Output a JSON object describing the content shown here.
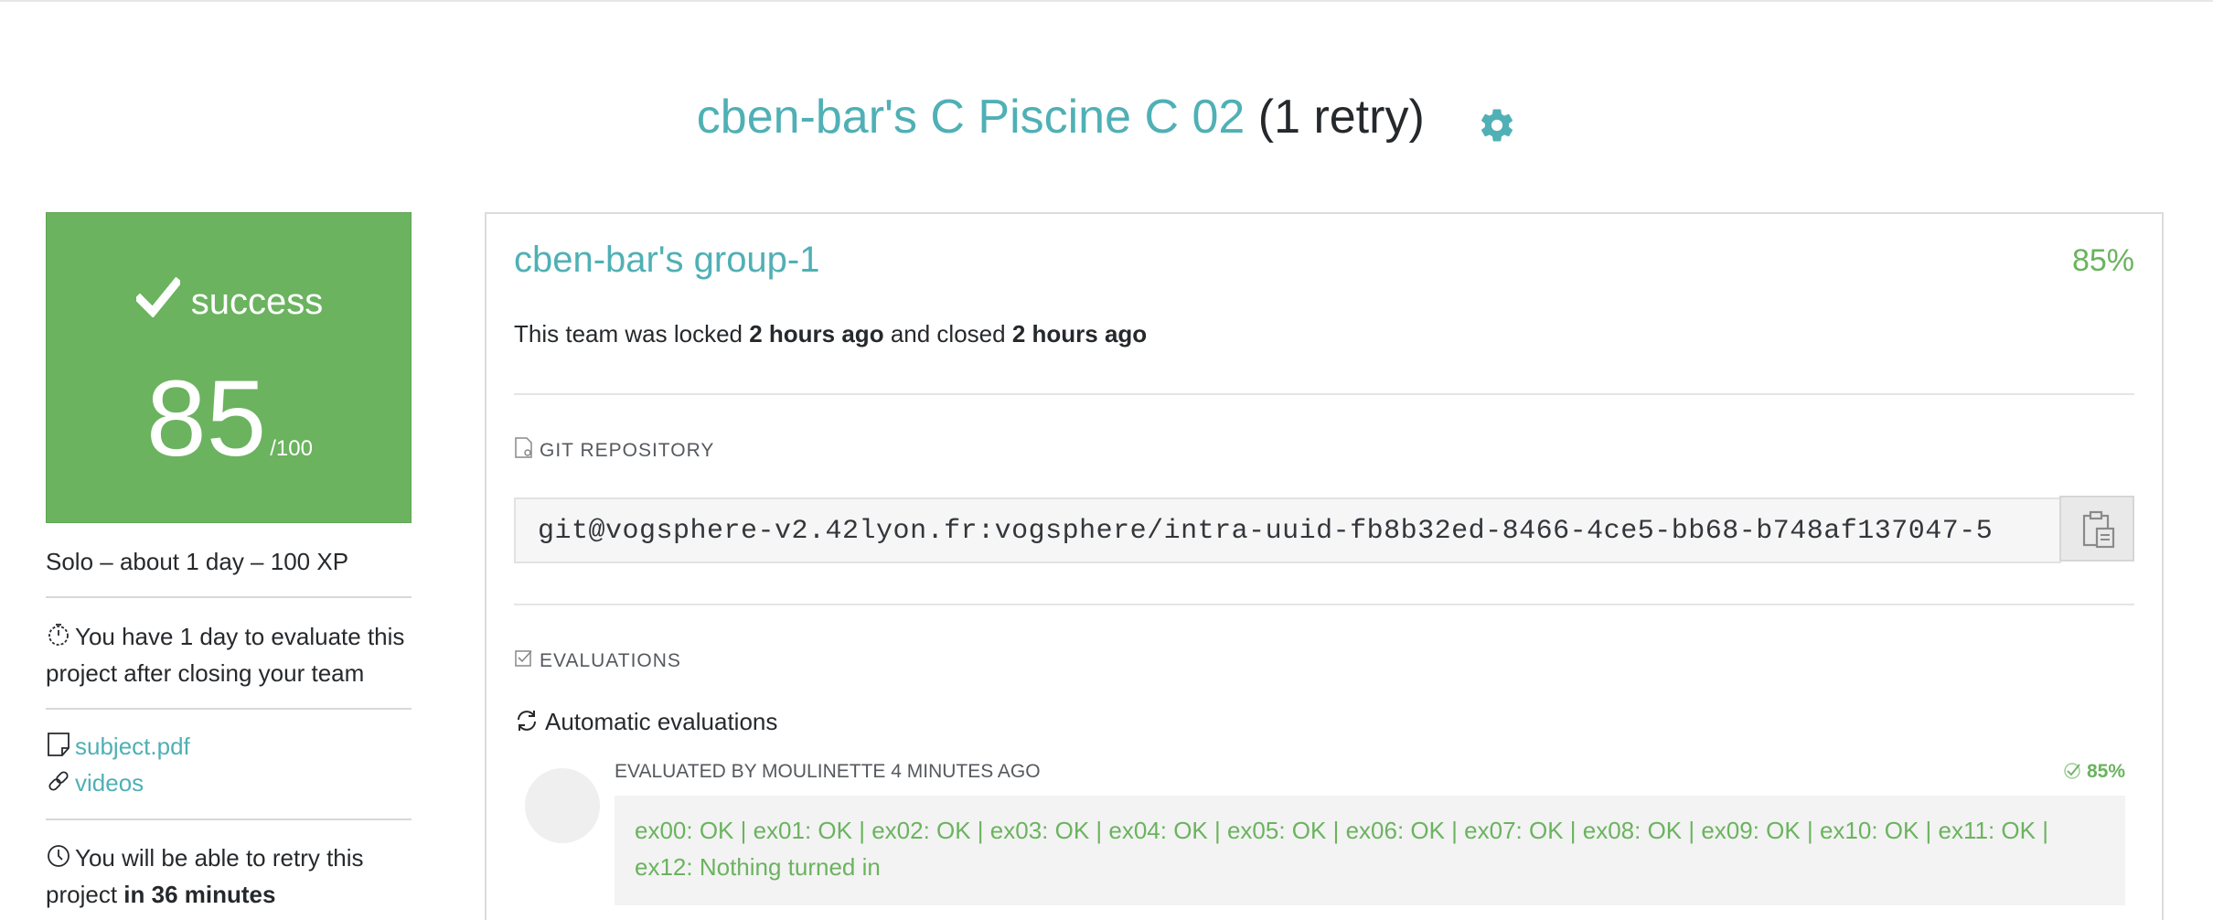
{
  "title": {
    "main": "cben-bar's C Piscine C 02",
    "retry": "(1 retry)",
    "settings_icon": "gear-icon",
    "accent_color": "#4fb0b5"
  },
  "result": {
    "status": "success",
    "score": "85",
    "max": "/100",
    "status_color": "#6bb35f"
  },
  "sidebar": {
    "info": "Solo – about 1 day – 100 XP",
    "evaluate_notice": "You have 1 day to evaluate this project after closing your team",
    "links": [
      {
        "label": "subject.pdf",
        "icon": "document-icon"
      },
      {
        "label": "videos",
        "icon": "link-icon"
      }
    ],
    "retry_prefix": "You will be able to retry this project",
    "retry_time": "in 36 minutes"
  },
  "team": {
    "name": "cben-bar's group-1",
    "percent": "85%",
    "locked_prefix": "This team was locked",
    "locked_time": "2 hours ago",
    "closed_prefix": "and closed",
    "closed_time": "2 hours ago"
  },
  "git": {
    "heading": "GIT REPOSITORY",
    "url": "git@vogsphere-v2.42lyon.fr:vogsphere/intra-uuid-fb8b32ed-8466-4ce5-bb68-b748af137047-5"
  },
  "evaluations": {
    "heading": "EVALUATIONS",
    "automatic_title": "Automatic evaluations",
    "evaluated_by": "EVALUATED BY MOULINETTE 4 MINUTES AGO",
    "percent": "85%",
    "result_text": "ex00: OK | ex01: OK | ex02: OK | ex03: OK | ex04: OK | ex05: OK | ex06: OK | ex07: OK | ex08: OK | ex09: OK | ex10: OK | ex11: OK | ex12: Nothing turned in"
  }
}
